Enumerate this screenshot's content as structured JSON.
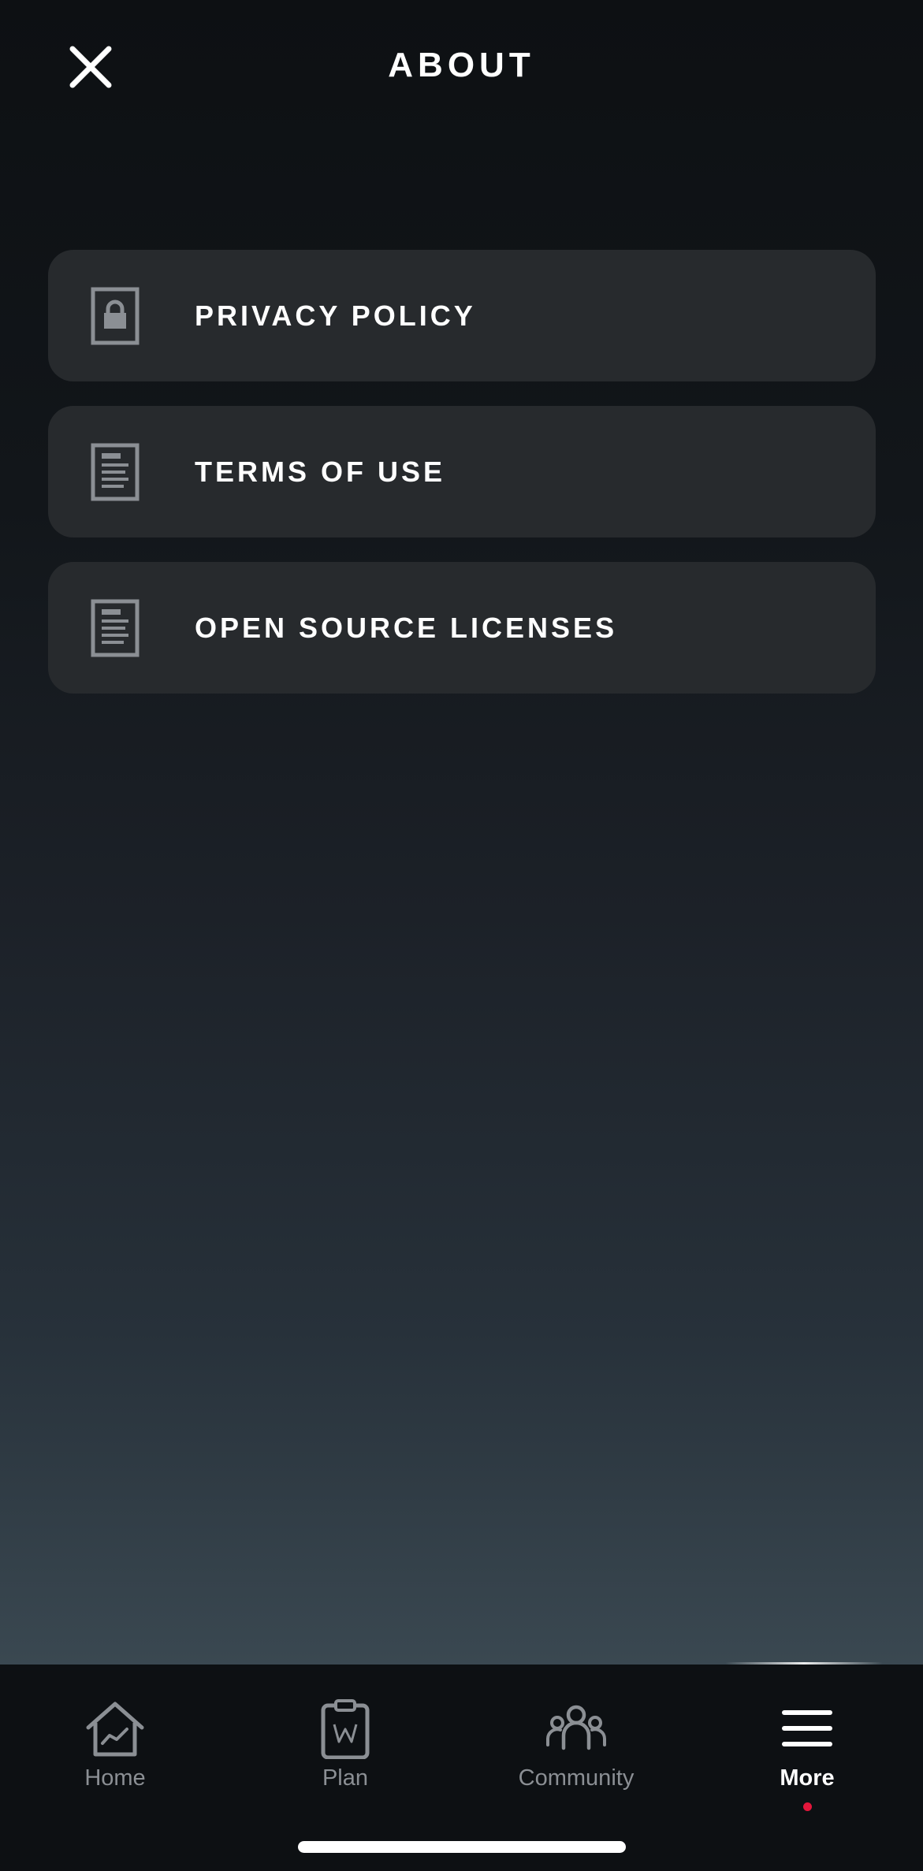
{
  "header": {
    "title": "ABOUT",
    "close_icon": "close-icon"
  },
  "menu": {
    "items": [
      {
        "label": "PRIVACY POLICY",
        "icon": "lock-document-icon"
      },
      {
        "label": "TERMS OF USE",
        "icon": "document-icon"
      },
      {
        "label": "OPEN SOURCE LICENSES",
        "icon": "document-icon"
      }
    ]
  },
  "tab_bar": {
    "tabs": [
      {
        "label": "Home",
        "icon": "home-chart-icon",
        "active": false
      },
      {
        "label": "Plan",
        "icon": "clipboard-icon",
        "active": false
      },
      {
        "label": "Community",
        "icon": "people-icon",
        "active": false
      },
      {
        "label": "More",
        "icon": "hamburger-menu-icon",
        "active": true
      }
    ]
  },
  "colors": {
    "background_top": "#0d1013",
    "background_bottom": "#3a4851",
    "card": "#272a2d",
    "icon_gray": "#8b8f94",
    "active_dot": "#e3163b",
    "text": "#ffffff"
  }
}
